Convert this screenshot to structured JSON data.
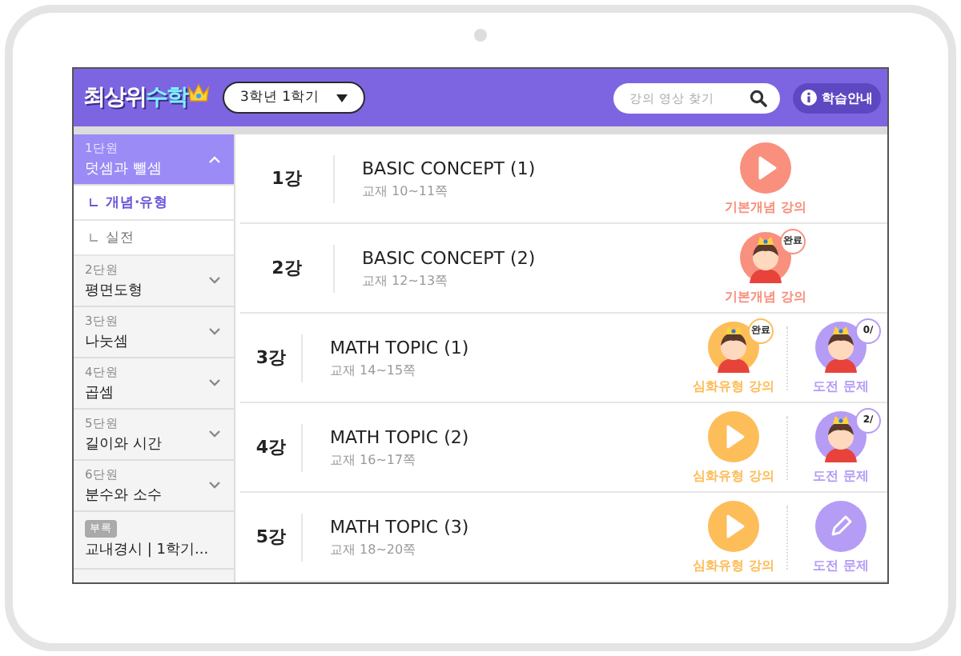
{
  "header": {
    "logo": "최상위",
    "logo_accent": "수학",
    "grade_select": "3학년 1학기",
    "search": {
      "placeholder": "강의 영상 찾기"
    },
    "guide_button": "학습안내"
  },
  "sidebar": [
    {
      "kind": "unit",
      "unit": "1단원",
      "title": "덧셈과 뺄셈",
      "expanded": true,
      "selected": true,
      "children": [
        {
          "label": "개념·유형",
          "selected": true
        },
        {
          "label": "실전",
          "selected": false
        }
      ]
    },
    {
      "kind": "unit",
      "unit": "2단원",
      "title": "평면도형",
      "expanded": false,
      "selected": false
    },
    {
      "kind": "unit",
      "unit": "3단원",
      "title": "나눗셈",
      "expanded": false,
      "selected": false
    },
    {
      "kind": "unit",
      "unit": "4단원",
      "title": "곱셈",
      "expanded": false,
      "selected": false
    },
    {
      "kind": "unit",
      "unit": "5단원",
      "title": "길이와 시간",
      "expanded": false,
      "selected": false
    },
    {
      "kind": "unit",
      "unit": "6단원",
      "title": "분수와 소수",
      "expanded": false,
      "selected": false
    },
    {
      "kind": "appendix",
      "unit": "부록",
      "title": "교내경시 | 1학기...",
      "selected": false
    }
  ],
  "lessons": [
    {
      "number": "1강",
      "title": "BASIC CONCEPT (1)",
      "pages": "교재 10~11쪽",
      "actions": [
        {
          "kind": "play",
          "color": "#f8907d",
          "label": "기본개념 강의"
        }
      ]
    },
    {
      "number": "2강",
      "title": "BASIC CONCEPT (2)",
      "pages": "교재 12~13쪽",
      "actions": [
        {
          "kind": "avatar",
          "color": "#f8907d",
          "label": "기본개념 강의",
          "badge": "완료"
        }
      ]
    },
    {
      "number": "3강",
      "title": "MATH TOPIC (1)",
      "pages": "교재 14~15쪽",
      "actions": [
        {
          "kind": "avatar",
          "color": "#fdbd59",
          "label": "심화유형 강의",
          "badge": "완료"
        },
        {
          "kind": "avatar",
          "color": "#b59cf5",
          "label": "도전 문제",
          "badge": "0/"
        }
      ]
    },
    {
      "number": "4강",
      "title": "MATH TOPIC (2)",
      "pages": "교재 16~17쪽",
      "actions": [
        {
          "kind": "play",
          "color": "#fdbd59",
          "label": "심화유형 강의"
        },
        {
          "kind": "avatar",
          "color": "#b59cf5",
          "label": "도전 문제",
          "badge": "2/"
        }
      ]
    },
    {
      "number": "5강",
      "title": "MATH TOPIC (3)",
      "pages": "교재 18~20쪽",
      "actions": [
        {
          "kind": "play",
          "color": "#fdbd59",
          "label": "심화유형 강의"
        },
        {
          "kind": "pencil",
          "color": "#b59cf5",
          "label": "도전 문제"
        }
      ]
    }
  ]
}
